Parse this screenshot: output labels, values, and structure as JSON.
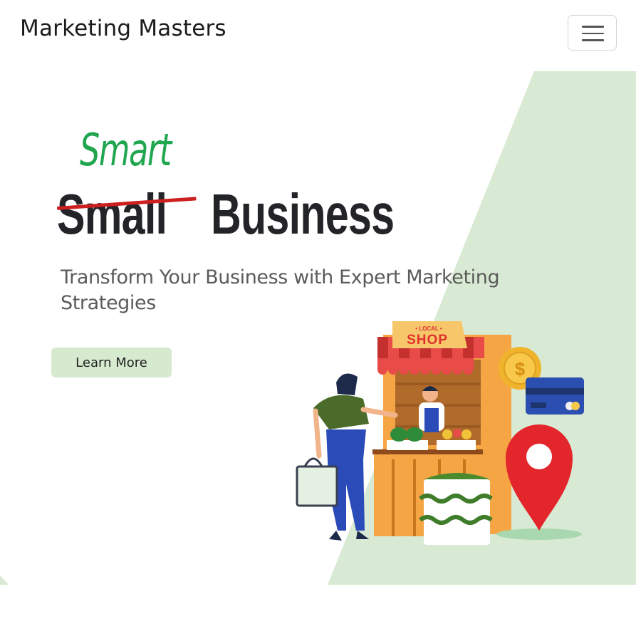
{
  "navbar": {
    "brand": "Marketing Masters",
    "menu_icon": "hamburger-menu-icon"
  },
  "hero": {
    "headline_overlay": "Smart",
    "headline_struck": "Small",
    "headline_main": "Business",
    "subtitle": "Transform Your Business with Expert Marketing Strategies",
    "cta_label": "Learn More",
    "illustration": {
      "sign_top": "• LOCAL •",
      "sign_main": "SHOP",
      "coin_symbol": "$"
    }
  },
  "colors": {
    "accent_green": "#1fa64e",
    "strike_red": "#cc1f1f",
    "hero_bg_green": "#d8ead3",
    "cta_bg": "#d6eacf",
    "headline_dark": "#232428"
  }
}
